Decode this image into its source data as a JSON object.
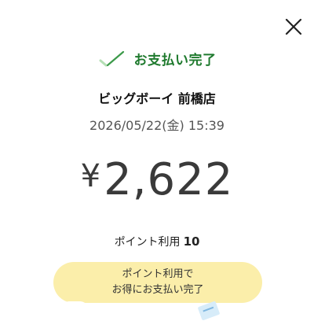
{
  "icons": {
    "close": "close-icon",
    "check": "check-mark-icon"
  },
  "colors": {
    "success": "#1f7a2e",
    "check_dark": "#3c9a4a",
    "check_light": "#b5dfb5",
    "promo_bg": "#fbeeaa",
    "amount_text": "#3a3a3a"
  },
  "status": {
    "text": "お支払い完了"
  },
  "merchant": {
    "name": "ビッグボーイ 前橋店"
  },
  "transaction": {
    "datetime": "2026/05/22(金) 15:39",
    "currency_symbol": "¥",
    "amount": "2,622"
  },
  "points": {
    "label": "ポイント利用",
    "value": "10"
  },
  "promo": {
    "line1": "ポイント利用で",
    "line2": "お得にお支払い完了"
  }
}
